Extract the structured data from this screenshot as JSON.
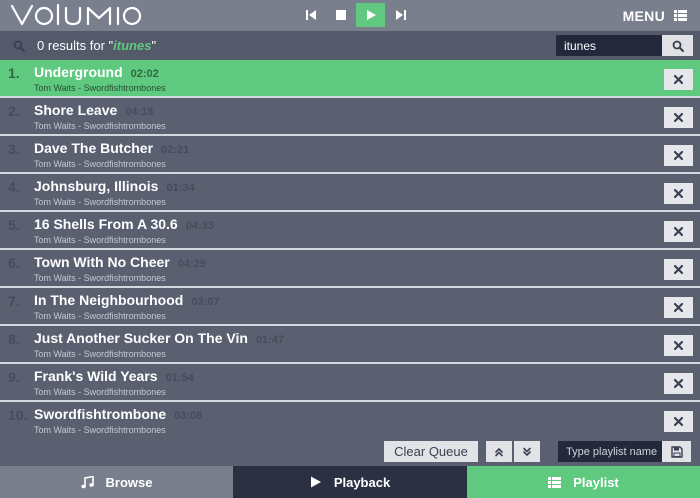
{
  "app": {
    "logo_text": "Volumio",
    "menu_label": "MENU"
  },
  "colors": {
    "accent": "#5fc980",
    "header": "#7a7f8e",
    "background": "#5b6071",
    "dark": "#2b3142"
  },
  "transport": {
    "buttons": [
      "previous-icon",
      "stop-icon",
      "play-icon",
      "next-icon"
    ]
  },
  "search": {
    "count": "0",
    "results_prefix": "results for \"",
    "query": "itunes",
    "results_suffix": "\"",
    "value": "itunes"
  },
  "queue": {
    "tracks": [
      {
        "num": "1.",
        "title": "Underground",
        "duration": "02:02",
        "artist": "Tom Waits - Swordfishtrombones",
        "active": true
      },
      {
        "num": "2.",
        "title": "Shore Leave",
        "duration": "04:18",
        "artist": "Tom Waits - Swordfishtrombones",
        "active": false
      },
      {
        "num": "3.",
        "title": "Dave The Butcher",
        "duration": "02:21",
        "artist": "Tom Waits - Swordfishtrombones",
        "active": false
      },
      {
        "num": "4.",
        "title": "Johnsburg, Illinois",
        "duration": "01:34",
        "artist": "Tom Waits - Swordfishtrombones",
        "active": false
      },
      {
        "num": "5.",
        "title": "16 Shells From A 30.6",
        "duration": "04:33",
        "artist": "Tom Waits - Swordfishtrombones",
        "active": false
      },
      {
        "num": "6.",
        "title": "Town With No Cheer",
        "duration": "04:29",
        "artist": "Tom Waits - Swordfishtrombones",
        "active": false
      },
      {
        "num": "7.",
        "title": "In The Neighbourhood",
        "duration": "03:07",
        "artist": "Tom Waits - Swordfishtrombones",
        "active": false
      },
      {
        "num": "8.",
        "title": "Just Another Sucker On The Vin",
        "duration": "01:47",
        "artist": "Tom Waits - Swordfishtrombones",
        "active": false
      },
      {
        "num": "9.",
        "title": "Frank's Wild Years",
        "duration": "01:54",
        "artist": "Tom Waits - Swordfishtrombones",
        "active": false
      },
      {
        "num": "10.",
        "title": "Swordfishtrombone",
        "duration": "03:08",
        "artist": "Tom Waits - Swordfishtrombones",
        "active": false
      }
    ],
    "clear_label": "Clear Queue",
    "playlist_placeholder": "Type playlist name"
  },
  "tabs": [
    {
      "label": "Browse",
      "icon": "music-note-icon"
    },
    {
      "label": "Playback",
      "icon": "play-icon"
    },
    {
      "label": "Playlist",
      "icon": "list-icon"
    }
  ]
}
